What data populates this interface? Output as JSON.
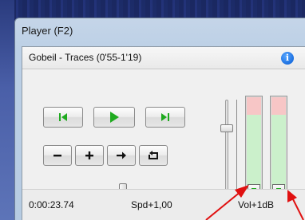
{
  "window": {
    "title": "Player (F2)"
  },
  "panel": {
    "title": "Gobeil - Traces (0'55-1'19)",
    "info_icon": "info-icon"
  },
  "transport": {
    "prev_icon": "skip-to-start-icon",
    "play_icon": "play-icon",
    "next_icon": "skip-to-end-icon",
    "minus_label": "−",
    "plus_label": "+",
    "arrow_icon": "right-arrow-icon",
    "loop_icon": "loop-icon"
  },
  "position_slider": {
    "value_fraction": 0.56
  },
  "volume_slider": {
    "value_fraction": 0.72
  },
  "meters": [
    {
      "name": "left-level-meter"
    },
    {
      "name": "right-level-meter"
    }
  ],
  "status": {
    "time": "0:00:23.74",
    "speed": "Spd+1,00",
    "volume": "Vol+1dB"
  },
  "colors": {
    "play_green": "#1faa1f",
    "meter_red": "#f7c6c6",
    "meter_green": "#cbf0cb",
    "annotation_red": "#e01010",
    "info_blue": "#1b6fe0"
  }
}
